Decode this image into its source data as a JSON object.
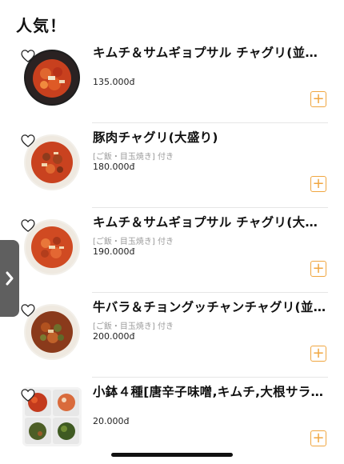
{
  "section": {
    "title": "人気！"
  },
  "items": [
    {
      "name": "キムチ＆サムギョプサル チャグリ(並盛…",
      "note": "",
      "price": "135.000đ",
      "add": "+"
    },
    {
      "name": "豚肉チャグリ(大盛り)",
      "note": "[ご飯・目玉焼き] 付き",
      "price": "180.000đ",
      "add": "+"
    },
    {
      "name": "キムチ＆サムギョプサル チャグリ(大盛…",
      "note": "[ご飯・目玉焼き] 付き",
      "price": "190.000đ",
      "add": "+"
    },
    {
      "name": "牛バラ＆チョングッチャンチャグリ(並…",
      "note": "[ご飯・目玉焼き] 付き",
      "price": "200.000đ",
      "add": "+"
    },
    {
      "name": "小鉢４種[唐辛子味噌,キムチ,大根サラ…",
      "note": "",
      "price": "20.000đ",
      "add": "+"
    }
  ],
  "icons": {
    "favorite": "heart-icon",
    "add": "plus-icon",
    "side_tab": "chevron-right-icon"
  },
  "colors": {
    "accent": "#f0a640",
    "side_tab": "#5f5f5f"
  }
}
